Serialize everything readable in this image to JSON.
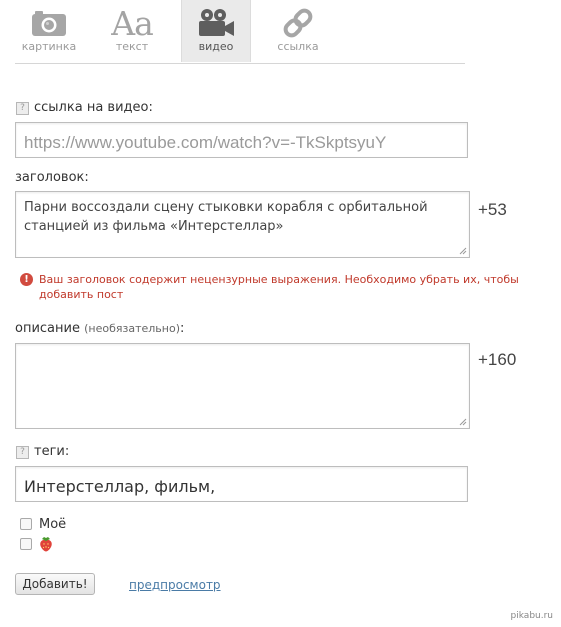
{
  "tabs": [
    {
      "label": "картинка",
      "icon": "camera-icon"
    },
    {
      "label": "текст",
      "icon": "text-aa-icon",
      "glyph": "Aa"
    },
    {
      "label": "видео",
      "icon": "video-camera-icon",
      "active": true
    },
    {
      "label": "ссылка",
      "icon": "link-icon"
    }
  ],
  "video": {
    "help": "?",
    "label": "ссылка на видео:",
    "value": "https://www.youtube.com/watch?v=-TkSkptsyuY"
  },
  "title": {
    "label": "заголовок:",
    "value": "Парни воссоздали сцену стыковки корабля с орбитальной станцией из фильма «Интерстеллар»",
    "counter": "+53"
  },
  "error": {
    "icon": "!",
    "text": "Ваш заголовок содержит нецензурные выражения. Необходимо убрать их, чтобы добавить пост"
  },
  "description": {
    "label": "описание",
    "optional": "(необязательно)",
    "colon": ":",
    "value": "",
    "counter": "+160"
  },
  "tags": {
    "help": "?",
    "label": "теги:",
    "value": "Интерстеллар, фильм,"
  },
  "options": [
    {
      "label": "Моё",
      "checked": false
    },
    {
      "label": "",
      "icon": "strawberry-icon",
      "checked": false
    }
  ],
  "actions": {
    "submit": "Добавить!",
    "preview": "предпросмотр"
  },
  "watermark": "pikabu.ru",
  "colors": {
    "error": "#c0392b",
    "link": "#4a7ba6",
    "tab_active": "#eaeaea"
  }
}
